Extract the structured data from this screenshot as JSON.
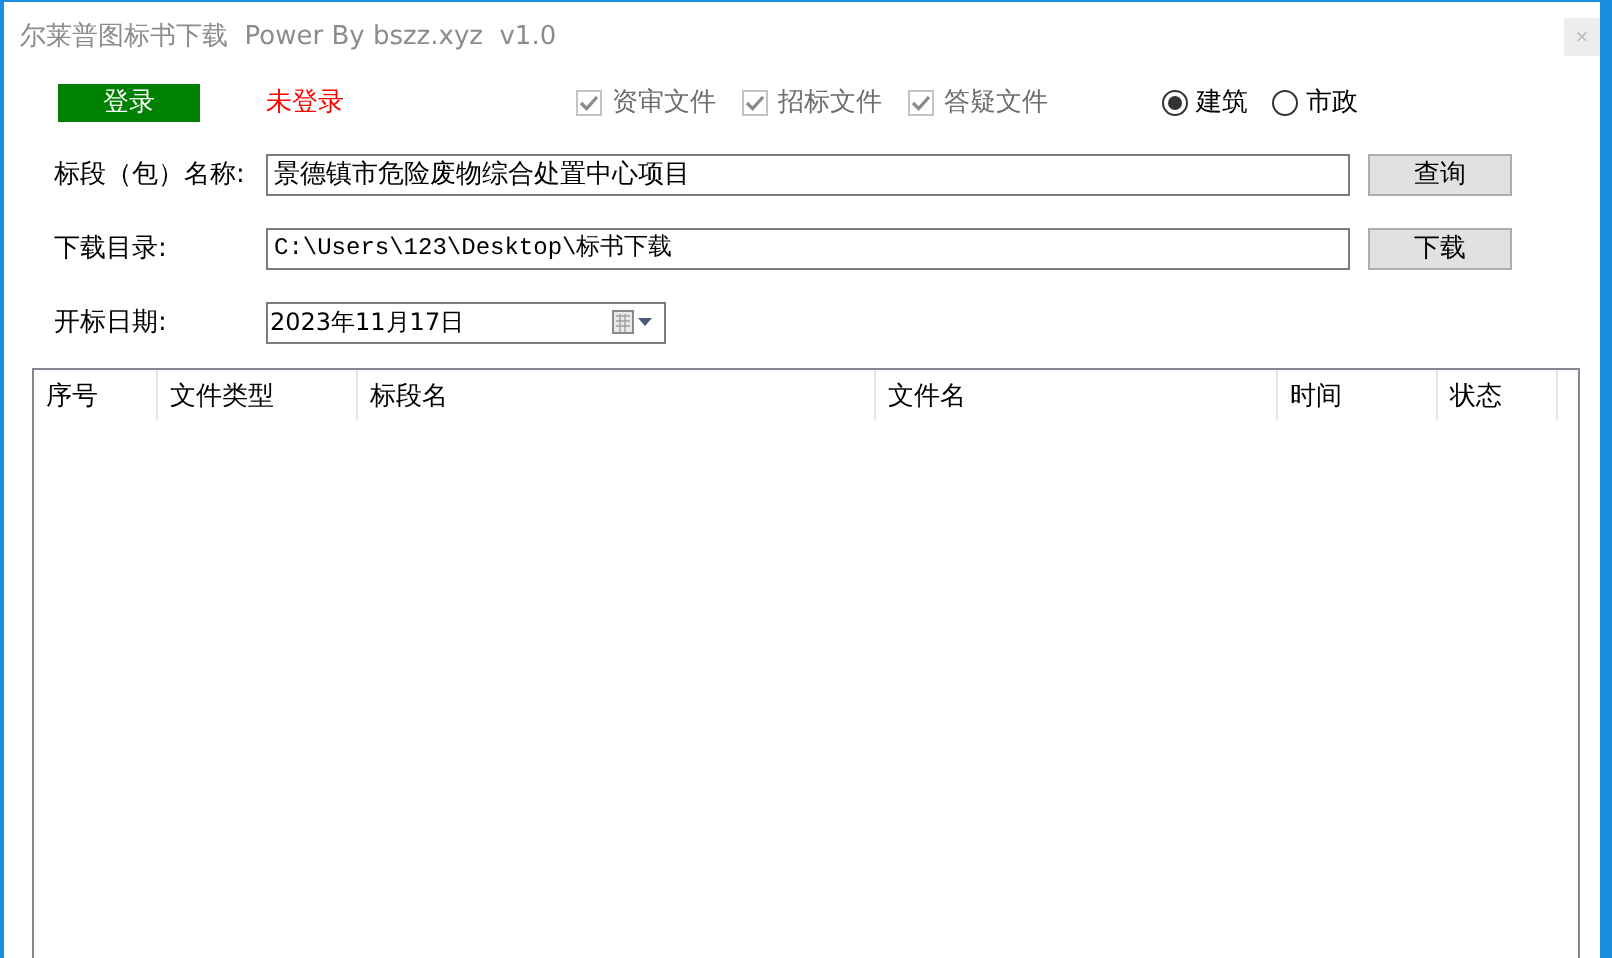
{
  "window": {
    "title": "尔莱普图标书下载  Power By bszz.xyz  v1.0",
    "close": "×"
  },
  "login_button": "登录",
  "login_status": "未登录",
  "checkboxes": [
    {
      "label": "资审文件",
      "checked": true,
      "disabled": true
    },
    {
      "label": "招标文件",
      "checked": true,
      "disabled": true
    },
    {
      "label": "答疑文件",
      "checked": true,
      "disabled": true
    }
  ],
  "radios": [
    {
      "label": "建筑",
      "selected": true
    },
    {
      "label": "市政",
      "selected": false
    }
  ],
  "name_row": {
    "label": "标段（包）名称:",
    "value": "景德镇市危险废物综合处置中心项目",
    "button": "查询"
  },
  "dir_row": {
    "label": "下载目录:",
    "value": "C:\\Users\\123\\Desktop\\标书下载",
    "button": "下载"
  },
  "date_row": {
    "label": "开标日期:",
    "value": "2023年11月17日"
  },
  "table": {
    "columns": [
      "序号",
      "文件类型",
      "标段名",
      "文件名",
      "时间",
      "状态"
    ]
  }
}
